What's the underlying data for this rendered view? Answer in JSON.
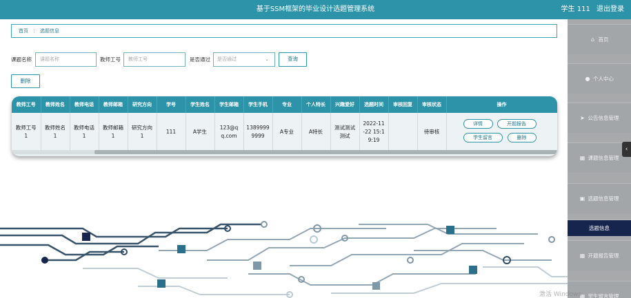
{
  "header": {
    "title": "基于SSM框架的毕业设计选题管理系统",
    "user": "学生 111",
    "logout": "退出登录"
  },
  "breadcrumb": {
    "home": "首页",
    "sep": "⋮",
    "current": "选题信息"
  },
  "search": {
    "title_label": "课题名称",
    "title_placeholder": "课题名称",
    "teacher_label": "教师工号",
    "teacher_placeholder": "教师工号",
    "pass_label": "是否通过",
    "pass_placeholder": "是否通过",
    "query_button": "查询",
    "delete_button": "删除"
  },
  "table": {
    "headers": [
      "教师工号",
      "教师姓名",
      "教师电话",
      "教师邮箱",
      "研究方向",
      "学号",
      "学生姓名",
      "学生邮箱",
      "学生手机",
      "专业",
      "个人特长",
      "兴趣爱好",
      "选题时间",
      "审核回复",
      "审核状态",
      "操作"
    ],
    "row": {
      "teacher_no": "教师工号\n1",
      "teacher_name": "教师姓名\n1",
      "teacher_phone": "教师电话\n1",
      "teacher_email": "教师邮箱\n1",
      "research": "研究方向\n1",
      "student_no": "111",
      "student_name": "A学生",
      "student_email": "123@q\nq.com",
      "student_phone": "1389999\n9999",
      "major": "A专业",
      "specialty": "A特长",
      "hobby": "测试测试\n测试",
      "select_time": "2022-11\n-22 15:1\n9:19",
      "review_reply": "",
      "review_status": "待审核"
    },
    "actions": {
      "detail": "详情",
      "proposal": "开题报告",
      "message": "学生留言",
      "delete": "删除"
    }
  },
  "sidebar": {
    "items": [
      {
        "label": "首页",
        "icon": "home-icon",
        "glyph": "⌂"
      },
      {
        "label": "个人中心",
        "icon": "user-icon",
        "glyph": "●"
      },
      {
        "label": "公告信息管理",
        "icon": "send-icon",
        "glyph": "➤"
      },
      {
        "label": "课题信息管理",
        "icon": "grid-icon",
        "glyph": "▦"
      },
      {
        "label": "选题信息管理",
        "icon": "trash-icon",
        "glyph": "▣"
      },
      {
        "label": "选题信息",
        "icon": "",
        "glyph": ""
      },
      {
        "label": "开题报告管理",
        "icon": "grid-icon",
        "glyph": "▦"
      },
      {
        "label": "学生留言管理",
        "icon": "grid-icon",
        "glyph": "▦"
      }
    ],
    "collapse_glyph": "‹"
  },
  "watermark": "激活 Windows",
  "colors": {
    "primary": "#2c93a8",
    "sidebar": "#a7a9ab",
    "active": "#15254e"
  }
}
